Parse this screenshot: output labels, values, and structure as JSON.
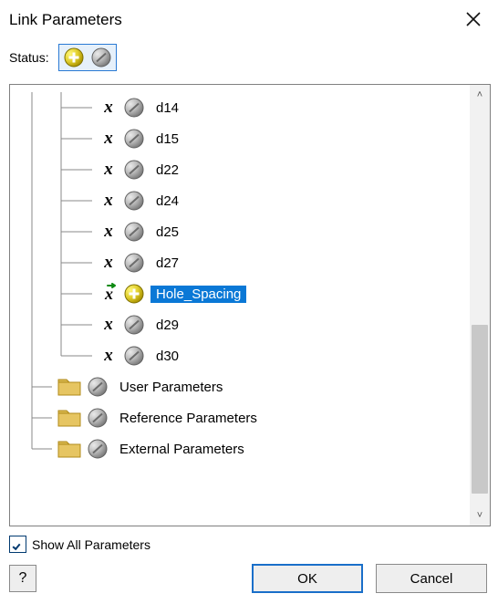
{
  "window": {
    "title": "Link Parameters"
  },
  "status": {
    "label": "Status:"
  },
  "tree": {
    "params": [
      {
        "kind": "param",
        "name": "d14",
        "selected": false,
        "icon": "gray",
        "glyph": "x"
      },
      {
        "kind": "param",
        "name": "d15",
        "selected": false,
        "icon": "gray",
        "glyph": "x"
      },
      {
        "kind": "param",
        "name": "d22",
        "selected": false,
        "icon": "gray",
        "glyph": "x"
      },
      {
        "kind": "param",
        "name": "d24",
        "selected": false,
        "icon": "gray",
        "glyph": "x"
      },
      {
        "kind": "param",
        "name": "d25",
        "selected": false,
        "icon": "gray",
        "glyph": "x"
      },
      {
        "kind": "param",
        "name": "d27",
        "selected": false,
        "icon": "gray",
        "glyph": "x"
      },
      {
        "kind": "param",
        "name": "Hole_Spacing",
        "selected": true,
        "icon": "plus",
        "glyph": "xarrow"
      },
      {
        "kind": "param",
        "name": "d29",
        "selected": false,
        "icon": "gray",
        "glyph": "x"
      },
      {
        "kind": "param",
        "name": "d30",
        "selected": false,
        "icon": "gray",
        "glyph": "x",
        "last": true
      }
    ],
    "groups": [
      {
        "name": "User Parameters"
      },
      {
        "name": "Reference Parameters"
      },
      {
        "name": "External Parameters",
        "last": true
      }
    ]
  },
  "options": {
    "show_all": "Show All Parameters"
  },
  "buttons": {
    "ok": "OK",
    "cancel": "Cancel",
    "help_tip": "?"
  }
}
